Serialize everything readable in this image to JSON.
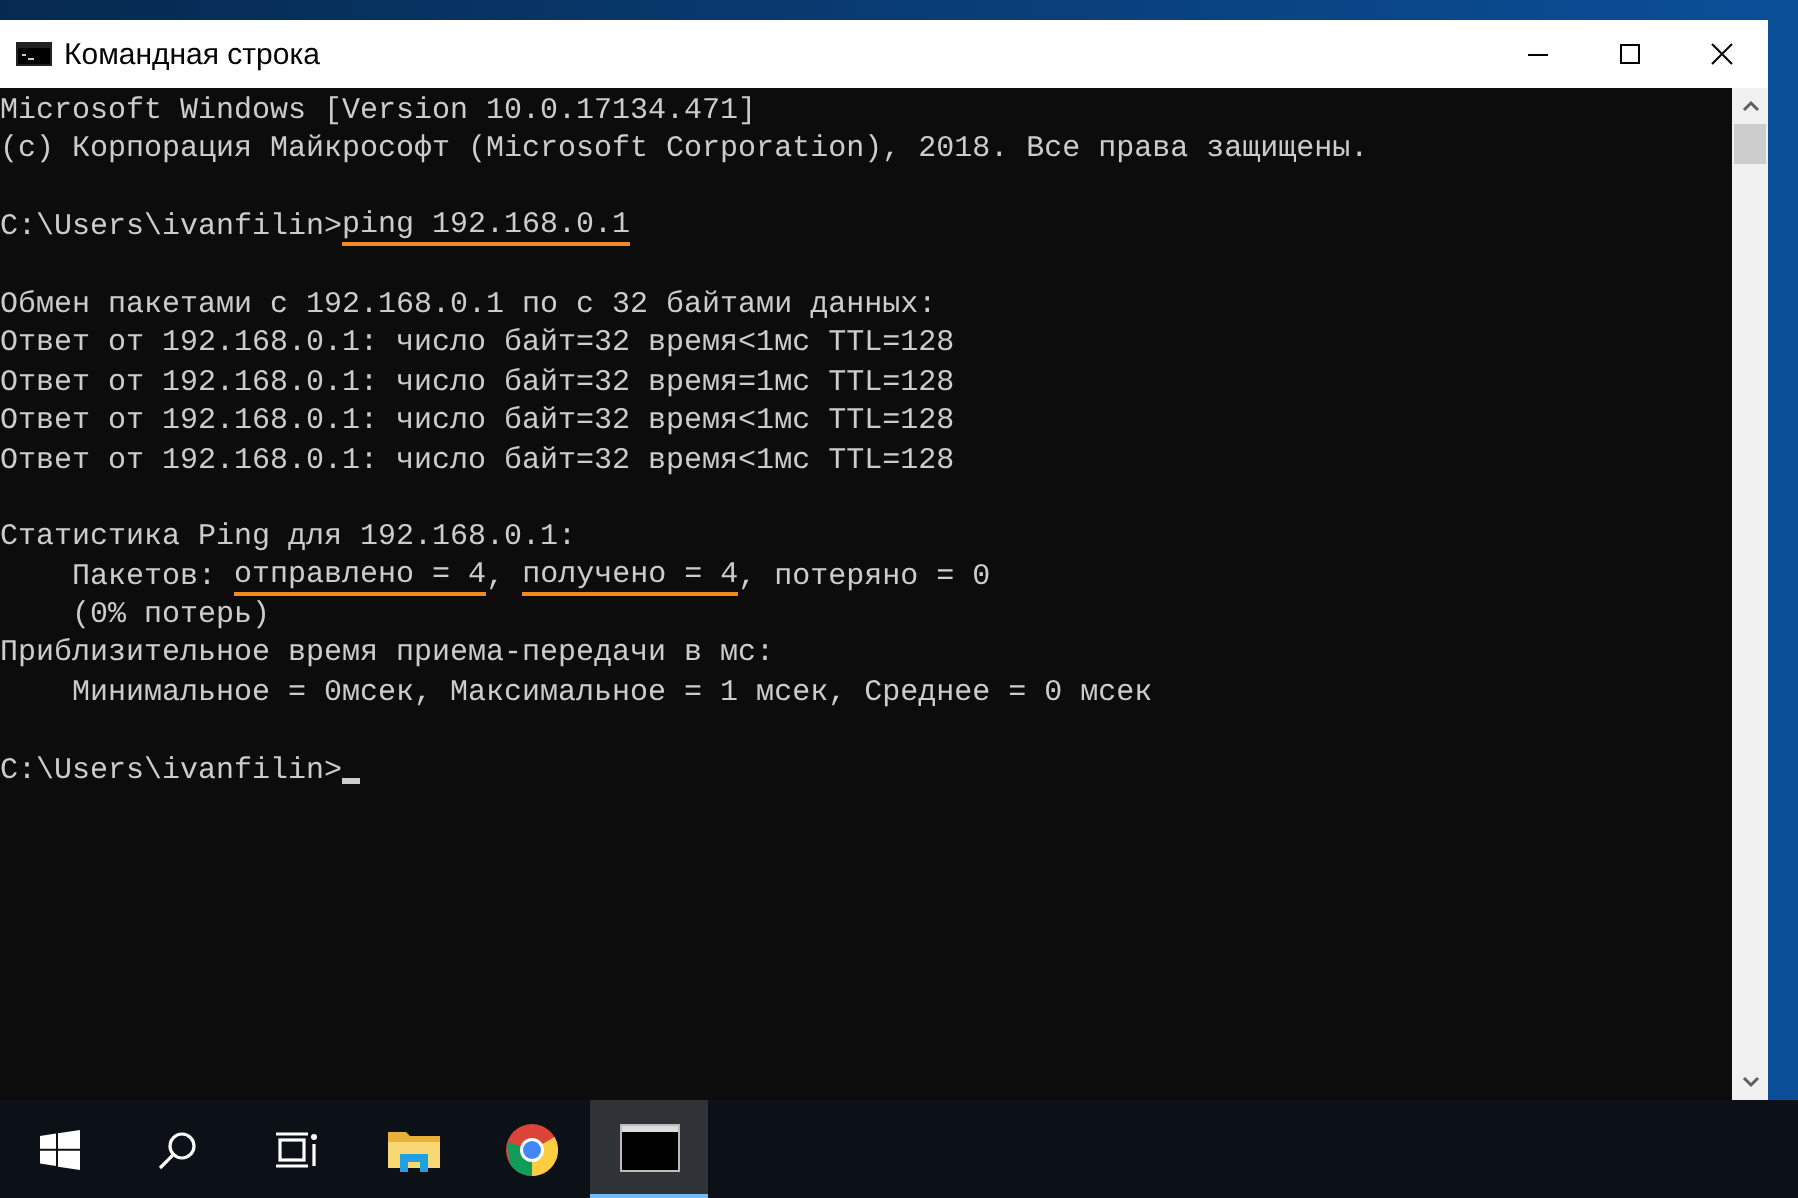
{
  "window": {
    "title": "Командная строка"
  },
  "console": {
    "lines": [
      {
        "kind": "text",
        "segments": [
          {
            "text": "Microsoft Windows [Version 10.0.17134.471]",
            "underlined": false
          }
        ]
      },
      {
        "kind": "text",
        "segments": [
          {
            "text": "(c) Корпорация Майкрософт (Microsoft Corporation), 2018. Все права защищены.",
            "underlined": false
          }
        ]
      },
      {
        "kind": "blank"
      },
      {
        "kind": "text",
        "segments": [
          {
            "text": "C:\\Users\\ivanfilin>",
            "underlined": false
          },
          {
            "text": "ping 192.168.0.1",
            "underlined": true
          }
        ]
      },
      {
        "kind": "blank"
      },
      {
        "kind": "text",
        "segments": [
          {
            "text": "Обмен пакетами с 192.168.0.1 по с 32 байтами данных:",
            "underlined": false
          }
        ]
      },
      {
        "kind": "text",
        "segments": [
          {
            "text": "Ответ от 192.168.0.1: число байт=32 время<1мс TTL=128",
            "underlined": false
          }
        ]
      },
      {
        "kind": "text",
        "segments": [
          {
            "text": "Ответ от 192.168.0.1: число байт=32 время=1мс TTL=128",
            "underlined": false
          }
        ]
      },
      {
        "kind": "text",
        "segments": [
          {
            "text": "Ответ от 192.168.0.1: число байт=32 время<1мс TTL=128",
            "underlined": false
          }
        ]
      },
      {
        "kind": "text",
        "segments": [
          {
            "text": "Ответ от 192.168.0.1: число байт=32 время<1мс TTL=128",
            "underlined": false
          }
        ]
      },
      {
        "kind": "blank"
      },
      {
        "kind": "text",
        "segments": [
          {
            "text": "Статистика Ping для 192.168.0.1:",
            "underlined": false
          }
        ]
      },
      {
        "kind": "text",
        "segments": [
          {
            "text": "    Пакетов: ",
            "underlined": false
          },
          {
            "text": "отправлено = 4",
            "underlined": true
          },
          {
            "text": ", ",
            "underlined": false
          },
          {
            "text": "получено = 4",
            "underlined": true
          },
          {
            "text": ", потеряно = 0",
            "underlined": false
          }
        ]
      },
      {
        "kind": "text",
        "segments": [
          {
            "text": "    (0% потерь)",
            "underlined": false
          }
        ]
      },
      {
        "kind": "text",
        "segments": [
          {
            "text": "Приблизительное время приема-передачи в мс:",
            "underlined": false
          }
        ]
      },
      {
        "kind": "text",
        "segments": [
          {
            "text": "    Минимальное = 0мсек, Максимальное = 1 мсек, Среднее = 0 мсек",
            "underlined": false
          }
        ]
      },
      {
        "kind": "blank"
      },
      {
        "kind": "prompt",
        "segments": [
          {
            "text": "C:\\Users\\ivanfilin>",
            "underlined": false
          }
        ]
      }
    ]
  },
  "taskbar": {
    "items": [
      {
        "kind": "start",
        "selected": false
      },
      {
        "kind": "search",
        "selected": false
      },
      {
        "kind": "taskview",
        "selected": false
      },
      {
        "kind": "explorer",
        "selected": false
      },
      {
        "kind": "chrome",
        "selected": false
      },
      {
        "kind": "console",
        "selected": true
      }
    ]
  }
}
